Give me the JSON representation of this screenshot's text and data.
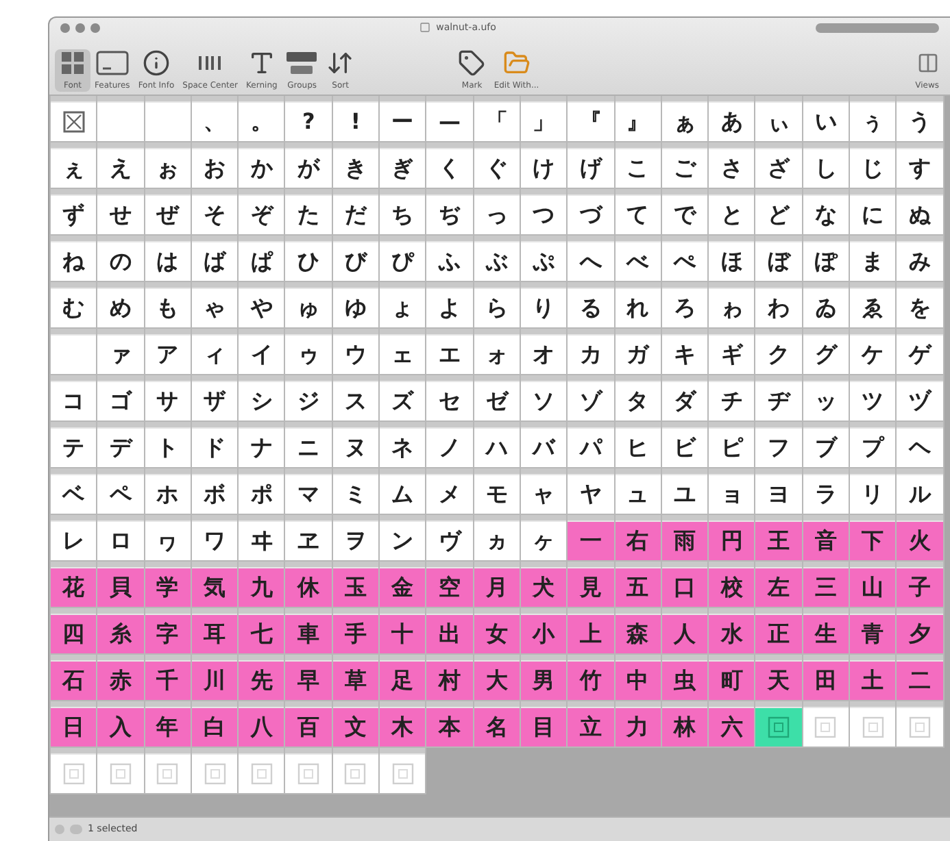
{
  "window": {
    "title": "walnut-a.ufo"
  },
  "toolbar": [
    {
      "label": "Font",
      "selected": true
    },
    {
      "label": "Features",
      "selected": false
    },
    {
      "label": "Font Info",
      "selected": false
    },
    {
      "label": "Space Center",
      "selected": false
    },
    {
      "label": "Kerning",
      "selected": false
    },
    {
      "label": "Groups",
      "selected": false
    },
    {
      "label": "Sort",
      "selected": false
    },
    {
      "label": "Mark",
      "selected": false
    },
    {
      "label": "Edit With...",
      "selected": false
    }
  ],
  "views": {
    "label": "Views"
  },
  "cells": [
    {
      "kind": "notdef",
      "selected": false
    },
    {
      "kind": "empty",
      "selected": false
    },
    {
      "kind": "empty",
      "selected": false
    },
    {
      "kind": "glyph",
      "glyph": "、",
      "selected": false
    },
    {
      "kind": "glyph",
      "glyph": "。",
      "selected": false
    },
    {
      "kind": "glyph",
      "glyph": "?",
      "selected": false
    },
    {
      "kind": "glyph",
      "glyph": "!",
      "selected": false
    },
    {
      "kind": "glyph",
      "glyph": "ー",
      "selected": false
    },
    {
      "kind": "glyph",
      "glyph": "—",
      "selected": false
    },
    {
      "kind": "glyph",
      "glyph": "「",
      "selected": false
    },
    {
      "kind": "glyph",
      "glyph": "」",
      "selected": false
    },
    {
      "kind": "glyph",
      "glyph": "『",
      "selected": false
    },
    {
      "kind": "glyph",
      "glyph": "』",
      "selected": false
    },
    {
      "kind": "glyph",
      "glyph": "ぁ",
      "selected": false
    },
    {
      "kind": "glyph",
      "glyph": "あ",
      "selected": false
    },
    {
      "kind": "glyph",
      "glyph": "ぃ",
      "selected": false
    },
    {
      "kind": "glyph",
      "glyph": "い",
      "selected": false
    },
    {
      "kind": "glyph",
      "glyph": "ぅ",
      "selected": false
    },
    {
      "kind": "glyph",
      "glyph": "う",
      "selected": false
    },
    {
      "kind": "glyph",
      "glyph": "ぇ",
      "selected": false
    },
    {
      "kind": "glyph",
      "glyph": "え",
      "selected": false
    },
    {
      "kind": "glyph",
      "glyph": "ぉ",
      "selected": false
    },
    {
      "kind": "glyph",
      "glyph": "お",
      "selected": false
    },
    {
      "kind": "glyph",
      "glyph": "か",
      "selected": false
    },
    {
      "kind": "glyph",
      "glyph": "が",
      "selected": false
    },
    {
      "kind": "glyph",
      "glyph": "き",
      "selected": false
    },
    {
      "kind": "glyph",
      "glyph": "ぎ",
      "selected": false
    },
    {
      "kind": "glyph",
      "glyph": "く",
      "selected": false
    },
    {
      "kind": "glyph",
      "glyph": "ぐ",
      "selected": false
    },
    {
      "kind": "glyph",
      "glyph": "け",
      "selected": false
    },
    {
      "kind": "glyph",
      "glyph": "げ",
      "selected": false
    },
    {
      "kind": "glyph",
      "glyph": "こ",
      "selected": false
    },
    {
      "kind": "glyph",
      "glyph": "ご",
      "selected": false
    },
    {
      "kind": "glyph",
      "glyph": "さ",
      "selected": false
    },
    {
      "kind": "glyph",
      "glyph": "ざ",
      "selected": false
    },
    {
      "kind": "glyph",
      "glyph": "し",
      "selected": false
    },
    {
      "kind": "glyph",
      "glyph": "じ",
      "selected": false
    },
    {
      "kind": "glyph",
      "glyph": "す",
      "selected": false
    },
    {
      "kind": "glyph",
      "glyph": "ず",
      "selected": false
    },
    {
      "kind": "glyph",
      "glyph": "せ",
      "selected": false
    },
    {
      "kind": "glyph",
      "glyph": "ぜ",
      "selected": false
    },
    {
      "kind": "glyph",
      "glyph": "そ",
      "selected": false
    },
    {
      "kind": "glyph",
      "glyph": "ぞ",
      "selected": false
    },
    {
      "kind": "glyph",
      "glyph": "た",
      "selected": false
    },
    {
      "kind": "glyph",
      "glyph": "だ",
      "selected": false
    },
    {
      "kind": "glyph",
      "glyph": "ち",
      "selected": false
    },
    {
      "kind": "glyph",
      "glyph": "ぢ",
      "selected": false
    },
    {
      "kind": "glyph",
      "glyph": "っ",
      "selected": false
    },
    {
      "kind": "glyph",
      "glyph": "つ",
      "selected": false
    },
    {
      "kind": "glyph",
      "glyph": "づ",
      "selected": false
    },
    {
      "kind": "glyph",
      "glyph": "て",
      "selected": false
    },
    {
      "kind": "glyph",
      "glyph": "で",
      "selected": false
    },
    {
      "kind": "glyph",
      "glyph": "と",
      "selected": false
    },
    {
      "kind": "glyph",
      "glyph": "ど",
      "selected": false
    },
    {
      "kind": "glyph",
      "glyph": "な",
      "selected": false
    },
    {
      "kind": "glyph",
      "glyph": "に",
      "selected": false
    },
    {
      "kind": "glyph",
      "glyph": "ぬ",
      "selected": false
    },
    {
      "kind": "glyph",
      "glyph": "ね",
      "selected": false
    },
    {
      "kind": "glyph",
      "glyph": "の",
      "selected": false
    },
    {
      "kind": "glyph",
      "glyph": "は",
      "selected": false
    },
    {
      "kind": "glyph",
      "glyph": "ば",
      "selected": false
    },
    {
      "kind": "glyph",
      "glyph": "ぱ",
      "selected": false
    },
    {
      "kind": "glyph",
      "glyph": "ひ",
      "selected": false
    },
    {
      "kind": "glyph",
      "glyph": "び",
      "selected": false
    },
    {
      "kind": "glyph",
      "glyph": "ぴ",
      "selected": false
    },
    {
      "kind": "glyph",
      "glyph": "ふ",
      "selected": false
    },
    {
      "kind": "glyph",
      "glyph": "ぶ",
      "selected": false
    },
    {
      "kind": "glyph",
      "glyph": "ぷ",
      "selected": false
    },
    {
      "kind": "glyph",
      "glyph": "へ",
      "selected": false
    },
    {
      "kind": "glyph",
      "glyph": "べ",
      "selected": false
    },
    {
      "kind": "glyph",
      "glyph": "ぺ",
      "selected": false
    },
    {
      "kind": "glyph",
      "glyph": "ほ",
      "selected": false
    },
    {
      "kind": "glyph",
      "glyph": "ぼ",
      "selected": false
    },
    {
      "kind": "glyph",
      "glyph": "ぽ",
      "selected": false
    },
    {
      "kind": "glyph",
      "glyph": "ま",
      "selected": false
    },
    {
      "kind": "glyph",
      "glyph": "み",
      "selected": false
    },
    {
      "kind": "glyph",
      "glyph": "む",
      "selected": false
    },
    {
      "kind": "glyph",
      "glyph": "め",
      "selected": false
    },
    {
      "kind": "glyph",
      "glyph": "も",
      "selected": false
    },
    {
      "kind": "glyph",
      "glyph": "ゃ",
      "selected": false
    },
    {
      "kind": "glyph",
      "glyph": "や",
      "selected": false
    },
    {
      "kind": "glyph",
      "glyph": "ゅ",
      "selected": false
    },
    {
      "kind": "glyph",
      "glyph": "ゆ",
      "selected": false
    },
    {
      "kind": "glyph",
      "glyph": "ょ",
      "selected": false
    },
    {
      "kind": "glyph",
      "glyph": "よ",
      "selected": false
    },
    {
      "kind": "glyph",
      "glyph": "ら",
      "selected": false
    },
    {
      "kind": "glyph",
      "glyph": "り",
      "selected": false
    },
    {
      "kind": "glyph",
      "glyph": "る",
      "selected": false
    },
    {
      "kind": "glyph",
      "glyph": "れ",
      "selected": false
    },
    {
      "kind": "glyph",
      "glyph": "ろ",
      "selected": false
    },
    {
      "kind": "glyph",
      "glyph": "ゎ",
      "selected": false
    },
    {
      "kind": "glyph",
      "glyph": "わ",
      "selected": false
    },
    {
      "kind": "glyph",
      "glyph": "ゐ",
      "selected": false
    },
    {
      "kind": "glyph",
      "glyph": "ゑ",
      "selected": false
    },
    {
      "kind": "glyph",
      "glyph": "を",
      "selected": false
    },
    {
      "kind": "empty",
      "selected": false
    },
    {
      "kind": "glyph",
      "glyph": "ァ",
      "selected": false
    },
    {
      "kind": "glyph",
      "glyph": "ア",
      "selected": false
    },
    {
      "kind": "glyph",
      "glyph": "ィ",
      "selected": false
    },
    {
      "kind": "glyph",
      "glyph": "イ",
      "selected": false
    },
    {
      "kind": "glyph",
      "glyph": "ゥ",
      "selected": false
    },
    {
      "kind": "glyph",
      "glyph": "ウ",
      "selected": false
    },
    {
      "kind": "glyph",
      "glyph": "ェ",
      "selected": false
    },
    {
      "kind": "glyph",
      "glyph": "エ",
      "selected": false
    },
    {
      "kind": "glyph",
      "glyph": "ォ",
      "selected": false
    },
    {
      "kind": "glyph",
      "glyph": "オ",
      "selected": false
    },
    {
      "kind": "glyph",
      "glyph": "カ",
      "selected": false
    },
    {
      "kind": "glyph",
      "glyph": "ガ",
      "selected": false
    },
    {
      "kind": "glyph",
      "glyph": "キ",
      "selected": false
    },
    {
      "kind": "glyph",
      "glyph": "ギ",
      "selected": false
    },
    {
      "kind": "glyph",
      "glyph": "ク",
      "selected": false
    },
    {
      "kind": "glyph",
      "glyph": "グ",
      "selected": false
    },
    {
      "kind": "glyph",
      "glyph": "ケ",
      "selected": false
    },
    {
      "kind": "glyph",
      "glyph": "ゲ",
      "selected": false
    },
    {
      "kind": "glyph",
      "glyph": "コ",
      "selected": false
    },
    {
      "kind": "glyph",
      "glyph": "ゴ",
      "selected": false
    },
    {
      "kind": "glyph",
      "glyph": "サ",
      "selected": false
    },
    {
      "kind": "glyph",
      "glyph": "ザ",
      "selected": false
    },
    {
      "kind": "glyph",
      "glyph": "シ",
      "selected": false
    },
    {
      "kind": "glyph",
      "glyph": "ジ",
      "selected": false
    },
    {
      "kind": "glyph",
      "glyph": "ス",
      "selected": false
    },
    {
      "kind": "glyph",
      "glyph": "ズ",
      "selected": false
    },
    {
      "kind": "glyph",
      "glyph": "セ",
      "selected": false
    },
    {
      "kind": "glyph",
      "glyph": "ゼ",
      "selected": false
    },
    {
      "kind": "glyph",
      "glyph": "ソ",
      "selected": false
    },
    {
      "kind": "glyph",
      "glyph": "ゾ",
      "selected": false
    },
    {
      "kind": "glyph",
      "glyph": "タ",
      "selected": false
    },
    {
      "kind": "glyph",
      "glyph": "ダ",
      "selected": false
    },
    {
      "kind": "glyph",
      "glyph": "チ",
      "selected": false
    },
    {
      "kind": "glyph",
      "glyph": "ヂ",
      "selected": false
    },
    {
      "kind": "glyph",
      "glyph": "ッ",
      "selected": false
    },
    {
      "kind": "glyph",
      "glyph": "ツ",
      "selected": false
    },
    {
      "kind": "glyph",
      "glyph": "ヅ",
      "selected": false
    },
    {
      "kind": "glyph",
      "glyph": "テ",
      "selected": false
    },
    {
      "kind": "glyph",
      "glyph": "デ",
      "selected": false
    },
    {
      "kind": "glyph",
      "glyph": "ト",
      "selected": false
    },
    {
      "kind": "glyph",
      "glyph": "ド",
      "selected": false
    },
    {
      "kind": "glyph",
      "glyph": "ナ",
      "selected": false
    },
    {
      "kind": "glyph",
      "glyph": "ニ",
      "selected": false
    },
    {
      "kind": "glyph",
      "glyph": "ヌ",
      "selected": false
    },
    {
      "kind": "glyph",
      "glyph": "ネ",
      "selected": false
    },
    {
      "kind": "glyph",
      "glyph": "ノ",
      "selected": false
    },
    {
      "kind": "glyph",
      "glyph": "ハ",
      "selected": false
    },
    {
      "kind": "glyph",
      "glyph": "バ",
      "selected": false
    },
    {
      "kind": "glyph",
      "glyph": "パ",
      "selected": false
    },
    {
      "kind": "glyph",
      "glyph": "ヒ",
      "selected": false
    },
    {
      "kind": "glyph",
      "glyph": "ビ",
      "selected": false
    },
    {
      "kind": "glyph",
      "glyph": "ピ",
      "selected": false
    },
    {
      "kind": "glyph",
      "glyph": "フ",
      "selected": false
    },
    {
      "kind": "glyph",
      "glyph": "ブ",
      "selected": false
    },
    {
      "kind": "glyph",
      "glyph": "プ",
      "selected": false
    },
    {
      "kind": "glyph",
      "glyph": "ヘ",
      "selected": false
    },
    {
      "kind": "glyph",
      "glyph": "ベ",
      "selected": false
    },
    {
      "kind": "glyph",
      "glyph": "ペ",
      "selected": false
    },
    {
      "kind": "glyph",
      "glyph": "ホ",
      "selected": false
    },
    {
      "kind": "glyph",
      "glyph": "ボ",
      "selected": false
    },
    {
      "kind": "glyph",
      "glyph": "ポ",
      "selected": false
    },
    {
      "kind": "glyph",
      "glyph": "マ",
      "selected": false
    },
    {
      "kind": "glyph",
      "glyph": "ミ",
      "selected": false
    },
    {
      "kind": "glyph",
      "glyph": "ム",
      "selected": false
    },
    {
      "kind": "glyph",
      "glyph": "メ",
      "selected": false
    },
    {
      "kind": "glyph",
      "glyph": "モ",
      "selected": false
    },
    {
      "kind": "glyph",
      "glyph": "ャ",
      "selected": false
    },
    {
      "kind": "glyph",
      "glyph": "ヤ",
      "selected": false
    },
    {
      "kind": "glyph",
      "glyph": "ュ",
      "selected": false
    },
    {
      "kind": "glyph",
      "glyph": "ユ",
      "selected": false
    },
    {
      "kind": "glyph",
      "glyph": "ョ",
      "selected": false
    },
    {
      "kind": "glyph",
      "glyph": "ヨ",
      "selected": false
    },
    {
      "kind": "glyph",
      "glyph": "ラ",
      "selected": false
    },
    {
      "kind": "glyph",
      "glyph": "リ",
      "selected": false
    },
    {
      "kind": "glyph",
      "glyph": "ル",
      "selected": false
    },
    {
      "kind": "glyph",
      "glyph": "レ",
      "selected": false
    },
    {
      "kind": "glyph",
      "glyph": "ロ",
      "selected": false
    },
    {
      "kind": "glyph",
      "glyph": "ヮ",
      "selected": false
    },
    {
      "kind": "glyph",
      "glyph": "ワ",
      "selected": false
    },
    {
      "kind": "glyph",
      "glyph": "ヰ",
      "selected": false
    },
    {
      "kind": "glyph",
      "glyph": "ヱ",
      "selected": false
    },
    {
      "kind": "glyph",
      "glyph": "ヲ",
      "selected": false
    },
    {
      "kind": "glyph",
      "glyph": "ン",
      "selected": false
    },
    {
      "kind": "glyph",
      "glyph": "ヴ",
      "selected": false
    },
    {
      "kind": "glyph",
      "glyph": "ヵ",
      "selected": false
    },
    {
      "kind": "glyph",
      "glyph": "ヶ",
      "selected": false
    },
    {
      "kind": "glyph",
      "glyph": "一",
      "color": "#f46cc0",
      "selected": false
    },
    {
      "kind": "glyph",
      "glyph": "右",
      "color": "#f46cc0",
      "selected": false
    },
    {
      "kind": "glyph",
      "glyph": "雨",
      "color": "#f46cc0",
      "selected": false
    },
    {
      "kind": "glyph",
      "glyph": "円",
      "color": "#f46cc0",
      "selected": false
    },
    {
      "kind": "glyph",
      "glyph": "王",
      "color": "#f46cc0",
      "selected": false
    },
    {
      "kind": "glyph",
      "glyph": "音",
      "color": "#f46cc0",
      "selected": false
    },
    {
      "kind": "glyph",
      "glyph": "下",
      "color": "#f46cc0",
      "selected": false
    },
    {
      "kind": "glyph",
      "glyph": "火",
      "color": "#f46cc0",
      "selected": false
    },
    {
      "kind": "glyph",
      "glyph": "花",
      "color": "#f46cc0",
      "selected": false
    },
    {
      "kind": "glyph",
      "glyph": "貝",
      "color": "#f46cc0",
      "selected": false
    },
    {
      "kind": "glyph",
      "glyph": "学",
      "color": "#f46cc0",
      "selected": false
    },
    {
      "kind": "glyph",
      "glyph": "気",
      "color": "#f46cc0",
      "selected": false
    },
    {
      "kind": "glyph",
      "glyph": "九",
      "color": "#f46cc0",
      "selected": false
    },
    {
      "kind": "glyph",
      "glyph": "休",
      "color": "#f46cc0",
      "selected": false
    },
    {
      "kind": "glyph",
      "glyph": "玉",
      "color": "#f46cc0",
      "selected": false
    },
    {
      "kind": "glyph",
      "glyph": "金",
      "color": "#f46cc0",
      "selected": false
    },
    {
      "kind": "glyph",
      "glyph": "空",
      "color": "#f46cc0",
      "selected": false
    },
    {
      "kind": "glyph",
      "glyph": "月",
      "color": "#f46cc0",
      "selected": false
    },
    {
      "kind": "glyph",
      "glyph": "犬",
      "color": "#f46cc0",
      "selected": false
    },
    {
      "kind": "glyph",
      "glyph": "見",
      "color": "#f46cc0",
      "selected": false
    },
    {
      "kind": "glyph",
      "glyph": "五",
      "color": "#f46cc0",
      "selected": false
    },
    {
      "kind": "glyph",
      "glyph": "口",
      "color": "#f46cc0",
      "selected": false
    },
    {
      "kind": "glyph",
      "glyph": "校",
      "color": "#f46cc0",
      "selected": false
    },
    {
      "kind": "glyph",
      "glyph": "左",
      "color": "#f46cc0",
      "selected": false
    },
    {
      "kind": "glyph",
      "glyph": "三",
      "color": "#f46cc0",
      "selected": false
    },
    {
      "kind": "glyph",
      "glyph": "山",
      "color": "#f46cc0",
      "selected": false
    },
    {
      "kind": "glyph",
      "glyph": "子",
      "color": "#f46cc0",
      "selected": false
    },
    {
      "kind": "glyph",
      "glyph": "四",
      "color": "#f46cc0",
      "selected": false
    },
    {
      "kind": "glyph",
      "glyph": "糸",
      "color": "#f46cc0",
      "selected": false
    },
    {
      "kind": "glyph",
      "glyph": "字",
      "color": "#f46cc0",
      "selected": false
    },
    {
      "kind": "glyph",
      "glyph": "耳",
      "color": "#f46cc0",
      "selected": false
    },
    {
      "kind": "glyph",
      "glyph": "七",
      "color": "#f46cc0",
      "selected": false
    },
    {
      "kind": "glyph",
      "glyph": "車",
      "color": "#f46cc0",
      "selected": false
    },
    {
      "kind": "glyph",
      "glyph": "手",
      "color": "#f46cc0",
      "selected": false
    },
    {
      "kind": "glyph",
      "glyph": "十",
      "color": "#f46cc0",
      "selected": false
    },
    {
      "kind": "glyph",
      "glyph": "出",
      "color": "#f46cc0",
      "selected": false
    },
    {
      "kind": "glyph",
      "glyph": "女",
      "color": "#f46cc0",
      "selected": false
    },
    {
      "kind": "glyph",
      "glyph": "小",
      "color": "#f46cc0",
      "selected": false
    },
    {
      "kind": "glyph",
      "glyph": "上",
      "color": "#f46cc0",
      "selected": false
    },
    {
      "kind": "glyph",
      "glyph": "森",
      "color": "#f46cc0",
      "selected": false
    },
    {
      "kind": "glyph",
      "glyph": "人",
      "color": "#f46cc0",
      "selected": false
    },
    {
      "kind": "glyph",
      "glyph": "水",
      "color": "#f46cc0",
      "selected": false
    },
    {
      "kind": "glyph",
      "glyph": "正",
      "color": "#f46cc0",
      "selected": false
    },
    {
      "kind": "glyph",
      "glyph": "生",
      "color": "#f46cc0",
      "selected": false
    },
    {
      "kind": "glyph",
      "glyph": "青",
      "color": "#f46cc0",
      "selected": false
    },
    {
      "kind": "glyph",
      "glyph": "夕",
      "color": "#f46cc0",
      "selected": false
    },
    {
      "kind": "glyph",
      "glyph": "石",
      "color": "#f46cc0",
      "selected": false
    },
    {
      "kind": "glyph",
      "glyph": "赤",
      "color": "#f46cc0",
      "selected": false
    },
    {
      "kind": "glyph",
      "glyph": "千",
      "color": "#f46cc0",
      "selected": false
    },
    {
      "kind": "glyph",
      "glyph": "川",
      "color": "#f46cc0",
      "selected": false
    },
    {
      "kind": "glyph",
      "glyph": "先",
      "color": "#f46cc0",
      "selected": false
    },
    {
      "kind": "glyph",
      "glyph": "早",
      "color": "#f46cc0",
      "selected": false
    },
    {
      "kind": "glyph",
      "glyph": "草",
      "color": "#f46cc0",
      "selected": false
    },
    {
      "kind": "glyph",
      "glyph": "足",
      "color": "#f46cc0",
      "selected": false
    },
    {
      "kind": "glyph",
      "glyph": "村",
      "color": "#f46cc0",
      "selected": false
    },
    {
      "kind": "glyph",
      "glyph": "大",
      "color": "#f46cc0",
      "selected": false
    },
    {
      "kind": "glyph",
      "glyph": "男",
      "color": "#f46cc0",
      "selected": false
    },
    {
      "kind": "glyph",
      "glyph": "竹",
      "color": "#f46cc0",
      "selected": false
    },
    {
      "kind": "glyph",
      "glyph": "中",
      "color": "#f46cc0",
      "selected": false
    },
    {
      "kind": "glyph",
      "glyph": "虫",
      "color": "#f46cc0",
      "selected": false
    },
    {
      "kind": "glyph",
      "glyph": "町",
      "color": "#f46cc0",
      "selected": false
    },
    {
      "kind": "glyph",
      "glyph": "天",
      "color": "#f46cc0",
      "selected": false
    },
    {
      "kind": "glyph",
      "glyph": "田",
      "color": "#f46cc0",
      "selected": false
    },
    {
      "kind": "glyph",
      "glyph": "土",
      "color": "#f46cc0",
      "selected": false
    },
    {
      "kind": "glyph",
      "glyph": "二",
      "color": "#f46cc0",
      "selected": false
    },
    {
      "kind": "glyph",
      "glyph": "日",
      "color": "#f46cc0",
      "selected": false
    },
    {
      "kind": "glyph",
      "glyph": "入",
      "color": "#f46cc0",
      "selected": false
    },
    {
      "kind": "glyph",
      "glyph": "年",
      "color": "#f46cc0",
      "selected": false
    },
    {
      "kind": "glyph",
      "glyph": "白",
      "color": "#f46cc0",
      "selected": false
    },
    {
      "kind": "glyph",
      "glyph": "八",
      "color": "#f46cc0",
      "selected": false
    },
    {
      "kind": "glyph",
      "glyph": "百",
      "color": "#f46cc0",
      "selected": false
    },
    {
      "kind": "glyph",
      "glyph": "文",
      "color": "#f46cc0",
      "selected": false
    },
    {
      "kind": "glyph",
      "glyph": "木",
      "color": "#f46cc0",
      "selected": false
    },
    {
      "kind": "glyph",
      "glyph": "本",
      "color": "#f46cc0",
      "selected": false
    },
    {
      "kind": "glyph",
      "glyph": "名",
      "color": "#f46cc0",
      "selected": false
    },
    {
      "kind": "glyph",
      "glyph": "目",
      "color": "#f46cc0",
      "selected": false
    },
    {
      "kind": "glyph",
      "glyph": "立",
      "color": "#f46cc0",
      "selected": false
    },
    {
      "kind": "glyph",
      "glyph": "力",
      "color": "#f46cc0",
      "selected": false
    },
    {
      "kind": "glyph",
      "glyph": "林",
      "color": "#f46cc0",
      "selected": false
    },
    {
      "kind": "glyph",
      "glyph": "六",
      "color": "#f46cc0",
      "selected": false
    },
    {
      "kind": "placeholder",
      "selected": true
    },
    {
      "kind": "placeholder",
      "selected": false
    },
    {
      "kind": "placeholder",
      "selected": false
    },
    {
      "kind": "placeholder",
      "selected": false
    },
    {
      "kind": "placeholder",
      "selected": false
    },
    {
      "kind": "placeholder",
      "selected": false
    },
    {
      "kind": "placeholder",
      "selected": false
    },
    {
      "kind": "placeholder",
      "selected": false
    },
    {
      "kind": "placeholder",
      "selected": false
    },
    {
      "kind": "placeholder",
      "selected": false
    },
    {
      "kind": "placeholder",
      "selected": false
    },
    {
      "kind": "placeholder",
      "selected": false
    }
  ],
  "status_bar": {
    "text": "1 selected"
  }
}
